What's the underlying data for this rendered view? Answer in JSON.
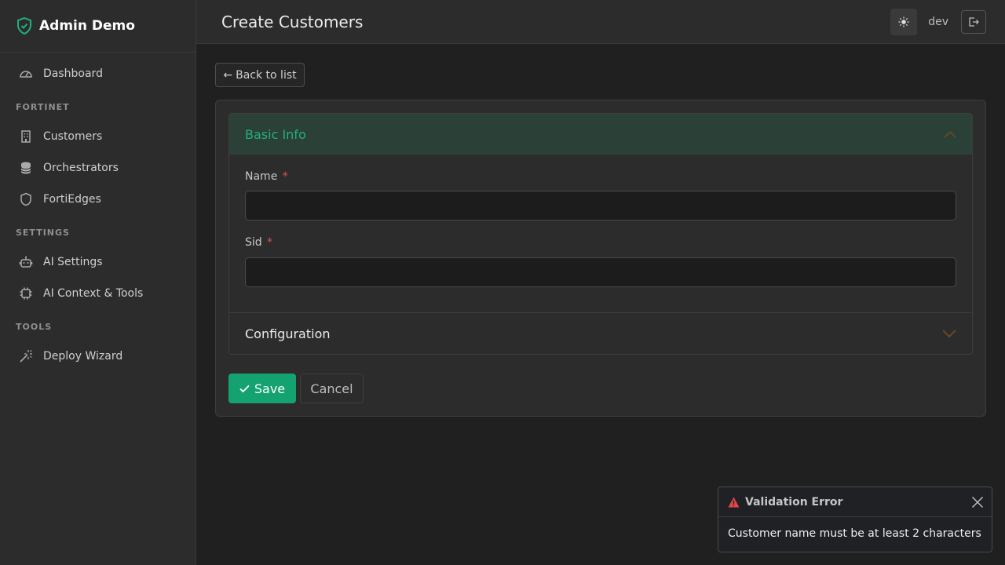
{
  "app": {
    "name": "Admin Demo"
  },
  "sidebar": {
    "items": [
      {
        "label": "Dashboard",
        "icon": "gauge-icon"
      },
      {
        "section": "FORTINET"
      },
      {
        "label": "Customers",
        "icon": "building-icon"
      },
      {
        "label": "Orchestrators",
        "icon": "database-icon"
      },
      {
        "label": "FortiEdges",
        "icon": "shield-icon"
      },
      {
        "section": "SETTINGS"
      },
      {
        "label": "AI Settings",
        "icon": "robot-icon"
      },
      {
        "label": "AI Context & Tools",
        "icon": "chip-icon"
      },
      {
        "section": "TOOLS"
      },
      {
        "label": "Deploy Wizard",
        "icon": "magic-wand-icon"
      }
    ]
  },
  "header": {
    "title": "Create Customers",
    "user": "dev",
    "theme_icon": "sun-icon",
    "logout_icon": "logout-icon"
  },
  "main": {
    "back_label": "Back to list",
    "sections": {
      "basic_info": "Basic Info",
      "configuration": "Configuration"
    },
    "fields": {
      "name": {
        "label": "Name",
        "required": "*",
        "value": "",
        "placeholder": ""
      },
      "sid": {
        "label": "Sid",
        "required": "*",
        "value": "",
        "placeholder": ""
      }
    },
    "save_label": "Save",
    "cancel_label": "Cancel"
  },
  "toast": {
    "title": "Validation Error",
    "message": "Customer name must be at least 2 characters"
  },
  "colors": {
    "accent": "#14a271",
    "accent_text": "#22b07d",
    "error": "#e05252",
    "chevron": "#7a4a1e"
  }
}
